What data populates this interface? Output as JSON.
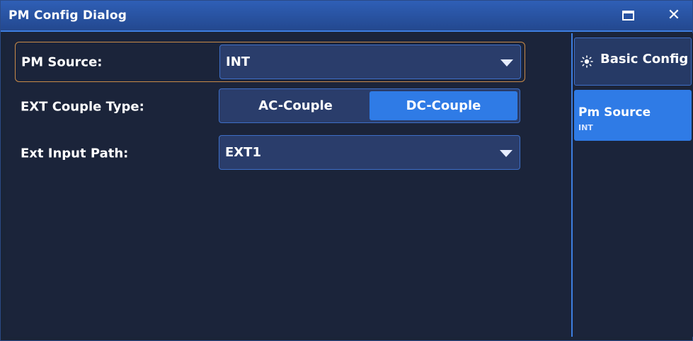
{
  "window": {
    "title": "PM Config Dialog",
    "maximize_icon": "maximize-icon",
    "close_icon": "close-icon"
  },
  "form": {
    "pm_source": {
      "label": "PM Source:",
      "value": "INT"
    },
    "ext_couple_type": {
      "label": "EXT Couple Type:",
      "options": [
        "AC-Couple",
        "DC-Couple"
      ],
      "selected": "DC-Couple"
    },
    "ext_input_path": {
      "label": "Ext Input Path:",
      "value": "EXT1"
    }
  },
  "sidebar": {
    "items": [
      {
        "label": "Basic Config",
        "icon": "gear-sun-icon"
      },
      {
        "label": "Pm Source",
        "sublabel": "INT"
      }
    ]
  },
  "colors": {
    "title_bar": "#2a56a6",
    "accent": "#2f7be6",
    "panel": "#1b243a",
    "selection_border": "#c98a48"
  }
}
